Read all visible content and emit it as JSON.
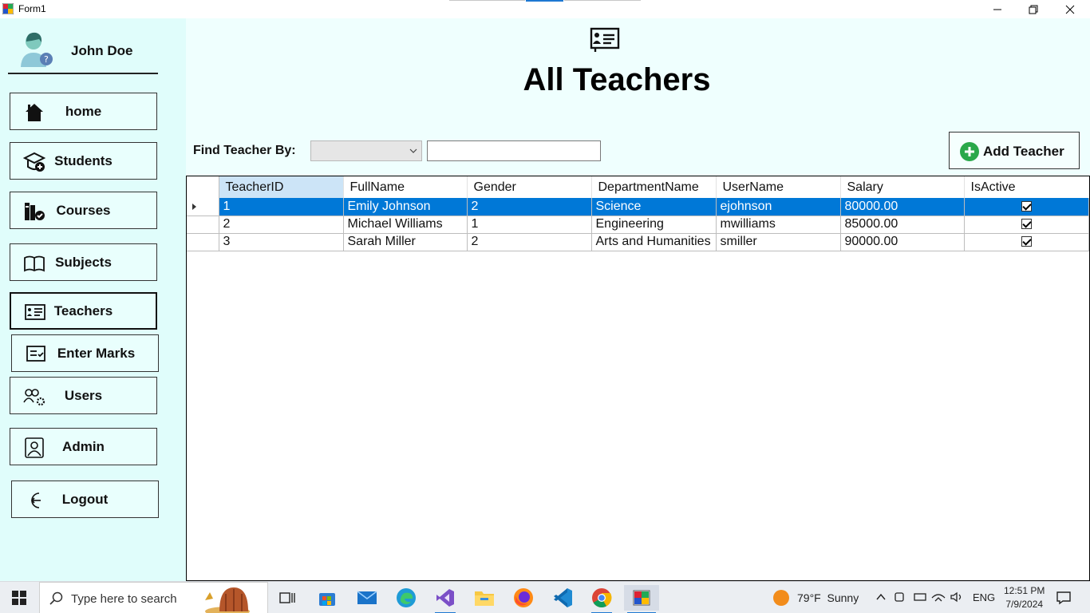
{
  "window": {
    "title": "Form1"
  },
  "user": {
    "name": "John Doe"
  },
  "sidebar": {
    "items": [
      {
        "label": "home",
        "icon": "home-icon"
      },
      {
        "label": "Students",
        "icon": "student-cap-icon"
      },
      {
        "label": "Courses",
        "icon": "books-check-icon"
      },
      {
        "label": "Subjects",
        "icon": "open-book-icon"
      },
      {
        "label": "Teachers",
        "icon": "teacher-board-icon"
      },
      {
        "label": "Enter Marks",
        "icon": "marks-list-icon"
      },
      {
        "label": "Users",
        "icon": "users-gear-icon"
      },
      {
        "label": "Admin",
        "icon": "admin-person-icon"
      },
      {
        "label": "Logout",
        "icon": "logout-icon"
      }
    ],
    "active": "Teachers"
  },
  "main": {
    "title": "All Teachers",
    "find_label": "Find Teacher By:",
    "filter_selected": "",
    "search_value": "",
    "add_button": "Add Teacher"
  },
  "grid": {
    "columns": [
      "TeacherID",
      "FullName",
      "Gender",
      "DepartmentName",
      "UserName",
      "Salary",
      "IsActive"
    ],
    "rows": [
      {
        "TeacherID": "1",
        "FullName": "Emily Johnson",
        "Gender": "2",
        "DepartmentName": "Science",
        "UserName": "ejohnson",
        "Salary": "80000.00",
        "IsActive": true
      },
      {
        "TeacherID": "2",
        "FullName": "Michael Williams",
        "Gender": "1",
        "DepartmentName": "Engineering",
        "UserName": "mwilliams",
        "Salary": "85000.00",
        "IsActive": true
      },
      {
        "TeacherID": "3",
        "FullName": "Sarah Miller",
        "Gender": "2",
        "DepartmentName": "Arts and Humanities",
        "UserName": "smiller",
        "Salary": "90000.00",
        "IsActive": true
      }
    ],
    "selected_row": 0
  },
  "taskbar": {
    "search_placeholder": "Type here to search",
    "weather": "79°F  Sunny",
    "language": "ENG",
    "time": "12:51 PM",
    "date": "7/9/2024"
  },
  "colors": {
    "selection": "#0078d7",
    "sidebar_bg": "#e0fdfb",
    "main_bg": "#effffe",
    "add_icon": "#2aa84a"
  }
}
